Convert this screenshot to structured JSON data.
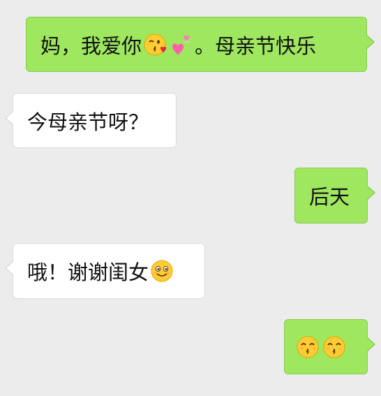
{
  "messages": [
    {
      "side": "sent",
      "text_before": "妈，我爱你",
      "emojis_mid": [
        "kissing-heart-emoji",
        "two-hearts-emoji"
      ],
      "text_after": "。母亲节快乐"
    },
    {
      "side": "received",
      "text": "今母亲节呀？"
    },
    {
      "side": "sent",
      "text": "后天"
    },
    {
      "side": "received",
      "text": "哦！谢谢闺女",
      "emojis_end": [
        "smiling-face-emoji"
      ]
    },
    {
      "side": "sent",
      "emojis": [
        "kissing-smiling-eyes-emoji",
        "kissing-smiling-eyes-emoji"
      ]
    }
  ],
  "colors": {
    "background": "#ececec",
    "sent_bubble": "#9ee75f",
    "received_bubble": "#ffffff",
    "text": "#111111"
  }
}
